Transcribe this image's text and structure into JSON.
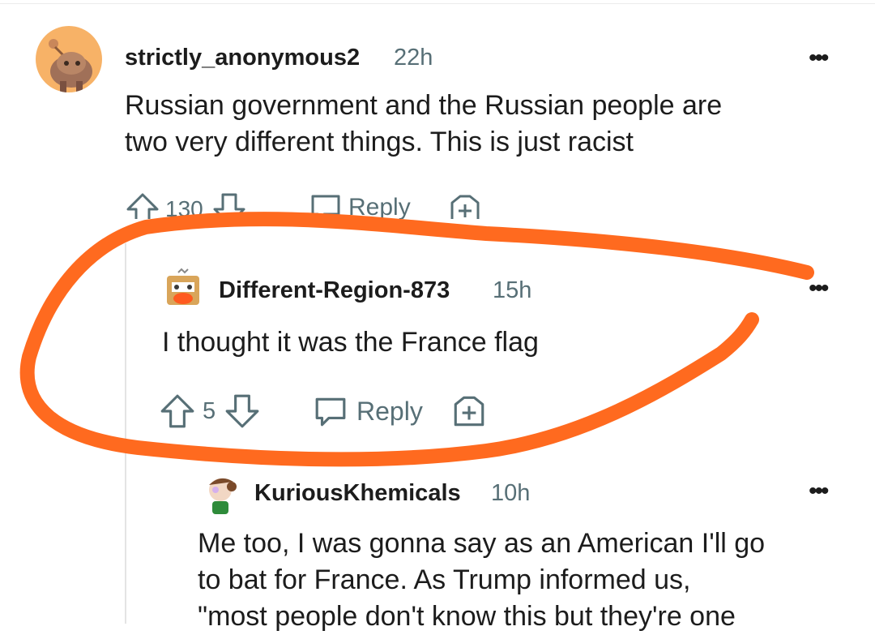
{
  "comments": [
    {
      "username": "strictly_anonymous2",
      "time": "22h",
      "body_lines": [
        "Russian government and the Russian people are",
        "two very different things. This is just racist"
      ],
      "votes": "130",
      "reply_label": "Reply"
    },
    {
      "username": "Different-Region-873",
      "time": "15h",
      "body_lines": [
        "I thought it was the France flag"
      ],
      "votes": "5",
      "reply_label": "Reply"
    },
    {
      "username": "KuriousKhemicals",
      "time": "10h",
      "body_lines": [
        "Me too, I was gonna say as an American I'll go",
        "to bat for France. As Trump informed us,",
        "\"most people don't know this but they're one"
      ]
    }
  ],
  "more_glyph": "•••",
  "colors": {
    "scribble": "#ff6a1f",
    "meta": "#576f76",
    "text": "#1c1c1c",
    "avatar_bg": "#f7b267"
  },
  "icons": [
    "upvote-icon",
    "downvote-icon",
    "reply-icon",
    "award-icon",
    "more-options-icon",
    "avatar-icon"
  ]
}
